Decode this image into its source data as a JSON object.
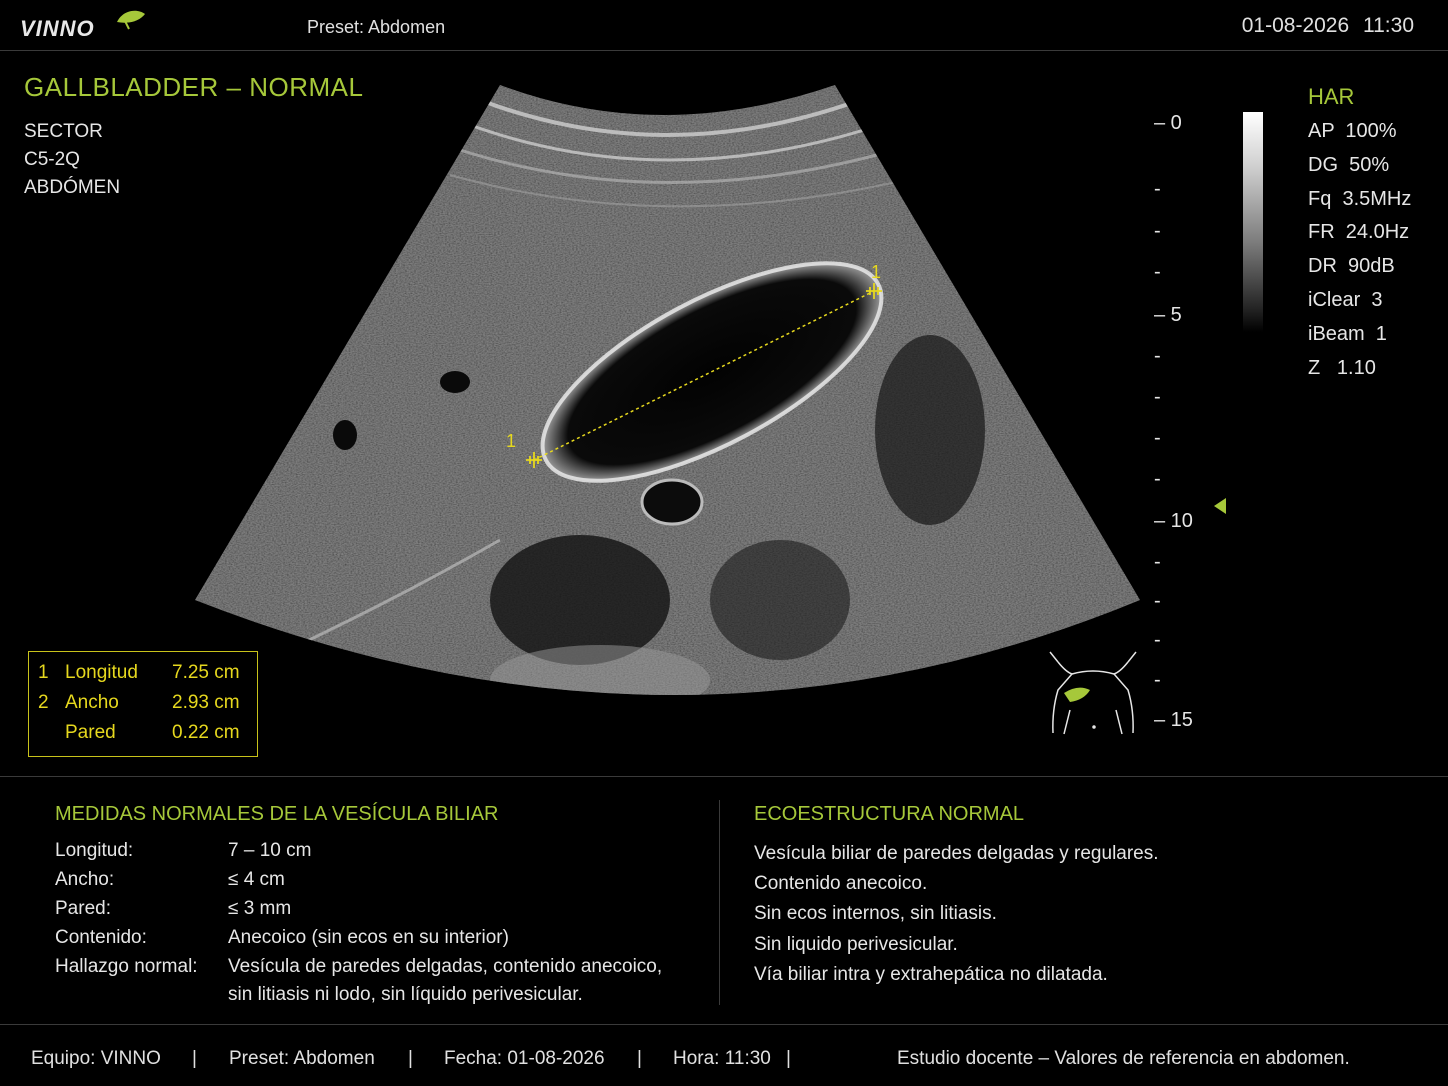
{
  "header": {
    "brand": "VINNO",
    "preset": "Preset: Abdomen",
    "date": "01-08-2026",
    "time": "11:30"
  },
  "exam": {
    "title": "GALLBLADDER – NORMAL",
    "info": [
      "SECTOR",
      "C5-2Q",
      "ABDÓMEN"
    ]
  },
  "imaging_params": {
    "mode": "HAR",
    "items": [
      "AP  100%",
      "DG  50%",
      "Fq  3.5MHz",
      "FR  24.0Hz",
      "DR  90dB",
      "iClear  3",
      "iBeam  1",
      "Z   1.10"
    ]
  },
  "depth_scale": {
    "labels": [
      "– 0",
      "-",
      "-",
      "-",
      "– 5",
      "-",
      "-",
      "-",
      "-",
      "– 10",
      "-",
      "-",
      "-",
      "-",
      "– 15"
    ]
  },
  "calipers": {
    "marker_a": "1",
    "marker_b": "1"
  },
  "measurements": [
    {
      "num": "1",
      "name": "Longitud",
      "value": "7.25 cm"
    },
    {
      "num": "2",
      "name": "Ancho",
      "value": "2.93 cm"
    },
    {
      "num": "",
      "name": "Pared",
      "value": "0.22 cm"
    }
  ],
  "normal_measures": {
    "title": "MEDIDAS NORMALES DE LA VESÍCULA BILIAR",
    "rows": [
      {
        "label": "Longitud:",
        "value": "7 – 10 cm"
      },
      {
        "label": "Ancho:",
        "value": "≤ 4 cm"
      },
      {
        "label": "Pared:",
        "value": "≤ 3 mm"
      },
      {
        "label": "Contenido:",
        "value": "Anecoico (sin ecos en su interior)"
      },
      {
        "label": "Hallazgo normal:",
        "value": "Vesícula de paredes delgadas, contenido anecoico,"
      },
      {
        "label": "",
        "value": "sin litiasis ni lodo, sin líquido perivesicular."
      }
    ]
  },
  "echostructure": {
    "title": "ECOESTRUCTURA NORMAL",
    "lines": [
      "Vesícula biliar de paredes delgadas y regulares.",
      "Contenido anecoico.",
      "Sin ecos internos, sin litiasis.",
      "Sin liquido perivesicular.",
      "Vía biliar intra y extrahepática no dilatada."
    ]
  },
  "footer": {
    "equipo": "Equipo: VINNO",
    "sep": "|",
    "preset": "Preset: Abdomen",
    "fecha": "Fecha: 01-08-2026",
    "hora": "Hora: 11:30",
    "note": "Estudio docente – Valores de referencia en abdomen."
  },
  "colors": {
    "accent": "#a6c83a",
    "caliper": "#e6d81e",
    "background": "#000000"
  }
}
